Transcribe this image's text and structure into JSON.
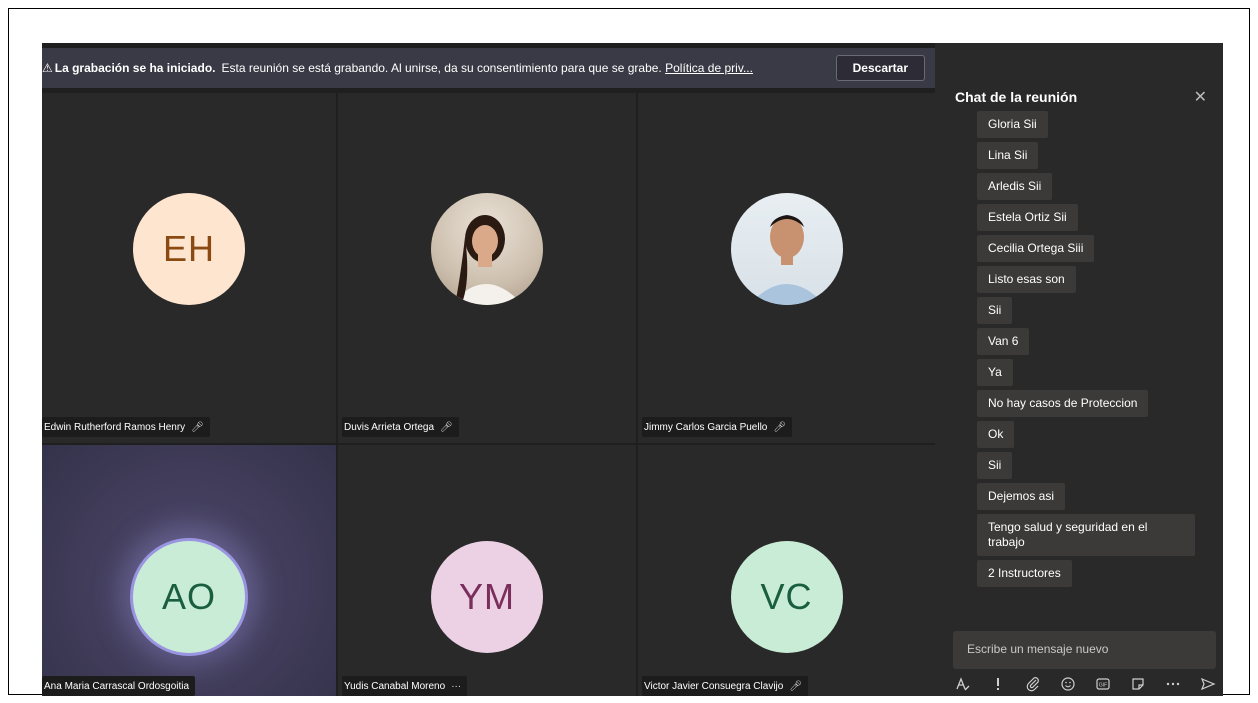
{
  "banner": {
    "warn_icon": "⚠",
    "title": "La grabación se ha iniciado.",
    "text": "Esta reunión se está grabando. Al unirse, da su consentimiento para que se grabe.",
    "link": "Política de priv...",
    "dismiss": "Descartar"
  },
  "participants": [
    {
      "name": "Edwin Rutherford Ramos Henry",
      "initials": "EH",
      "muted": true
    },
    {
      "name": "Duvis Arrieta Ortega",
      "muted": true
    },
    {
      "name": "Jimmy Carlos Garcia Puello",
      "muted": true
    },
    {
      "name": "Ana Maria Carrascal Ordosgoitia",
      "initials": "AO",
      "speaking": true
    },
    {
      "name": "Yudis Canabal Moreno",
      "initials": "YM",
      "more": "···"
    },
    {
      "name": "Victor Javier Consuegra Clavijo",
      "initials": "VC",
      "muted": true
    }
  ],
  "icons": {
    "mic_off": "🎙̸",
    "close": "✕"
  },
  "chat": {
    "title": "Chat de la reunión",
    "messages": [
      "Gloria Sii",
      "Lina Sii",
      "Arledis Sii",
      "Estela Ortiz Sii",
      "Cecilia Ortega Siii",
      "Listo esas son",
      "Sii",
      "Van 6",
      "Ya",
      "No hay casos de Proteccion",
      "Ok",
      "Sii",
      "Dejemos asi",
      "Tengo salud y seguridad en el trabajo",
      "2 Instructores"
    ],
    "composer_placeholder": "Escribe un mensaje nuevo",
    "toolbar_icons": [
      "format-icon",
      "important-icon",
      "attach-icon",
      "emoji-icon",
      "gif-icon",
      "sticker-icon",
      "more-icon",
      "send-icon"
    ]
  }
}
